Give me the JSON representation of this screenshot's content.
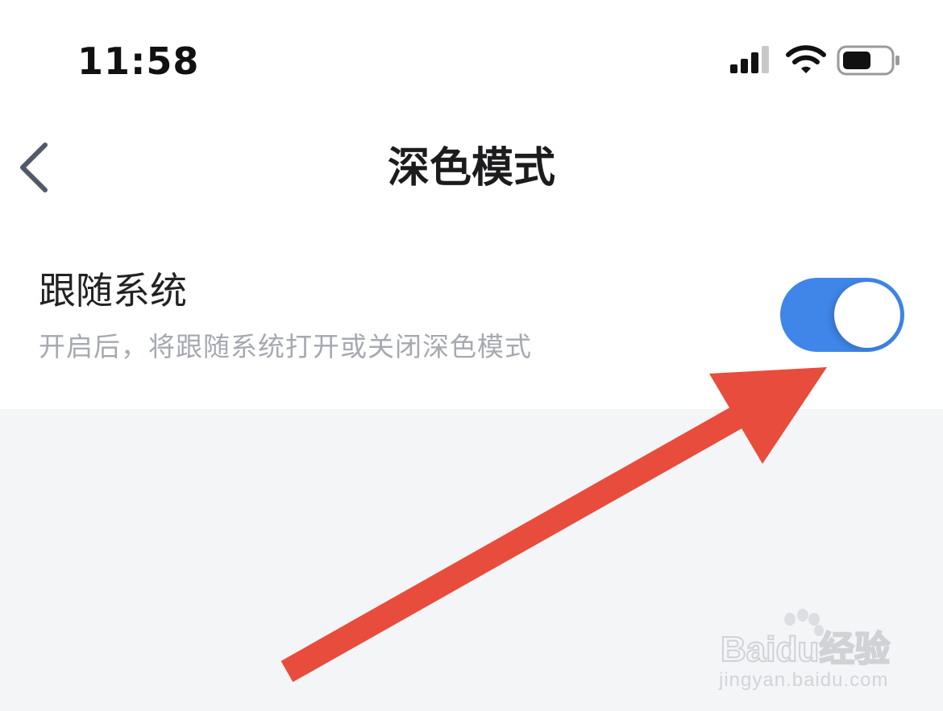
{
  "status_bar": {
    "time": "11:58",
    "icons": [
      "signal-icon",
      "wifi-icon",
      "battery-icon"
    ]
  },
  "nav": {
    "title": "深色模式",
    "back_icon": "chevron-left-icon"
  },
  "setting": {
    "label": "跟随系统",
    "description": "开启后，将跟随系统打开或关闭深色模式",
    "enabled": true
  },
  "colors": {
    "toggle_on": "#3f86e8",
    "annotation": "#e84c3d",
    "background": "#f4f5f7"
  },
  "watermark": {
    "logo": "Baidu经验",
    "url": "jingyan.baidu.com"
  }
}
